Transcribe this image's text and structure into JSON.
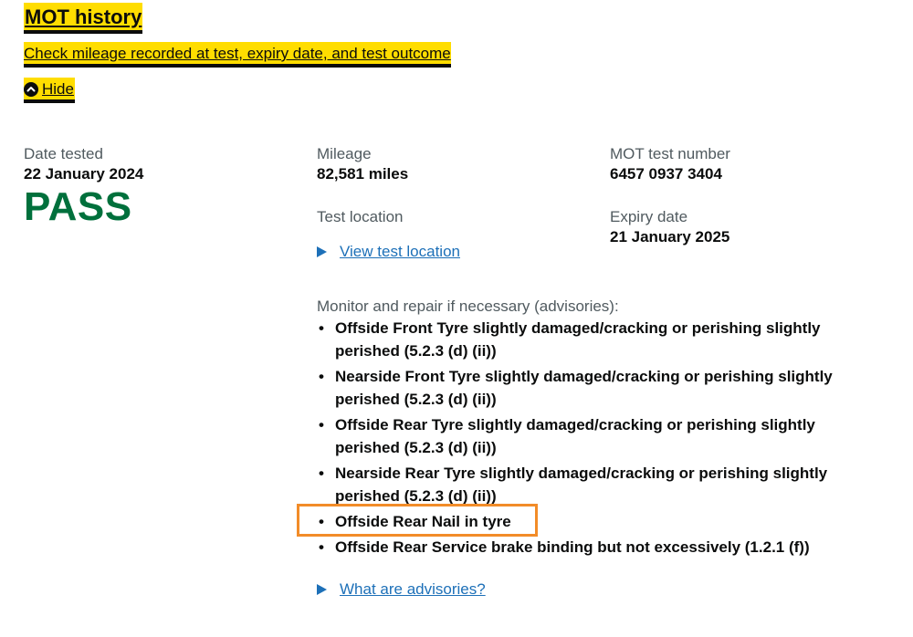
{
  "section": {
    "title": "MOT history",
    "summary": "Check mileage recorded at test, expiry date, and test outcome",
    "hide_label": "Hide"
  },
  "test": {
    "date_label": "Date tested",
    "date_value": "22 January 2024",
    "result": "PASS",
    "mileage_label": "Mileage",
    "mileage_value": "82,581 miles",
    "location_label": "Test location",
    "view_location_link": "View test location",
    "test_number_label": "MOT test number",
    "test_number_value": "6457 0937 3404",
    "expiry_label": "Expiry date",
    "expiry_value": "21 January 2025"
  },
  "advisories": {
    "heading": "Monitor and repair if necessary (advisories):",
    "items": [
      "Offside Front Tyre slightly damaged/cracking or perishing slightly perished (5.2.3 (d) (ii))",
      "Nearside Front Tyre slightly damaged/cracking or perishing slightly perished (5.2.3 (d) (ii))",
      "Offside Rear Tyre slightly damaged/cracking or perishing slightly perished (5.2.3 (d) (ii))",
      "Nearside Rear Tyre slightly damaged/cracking or perishing slightly perished (5.2.3 (d) (ii))",
      "Offside Rear Nail in tyre",
      "Offside Rear Service brake binding but not excessively (1.2.1 (f))"
    ],
    "what_are_link": "What are advisories?"
  },
  "colors": {
    "focus": "#ffdd00",
    "pass_green": "#00703c",
    "link_blue": "#1d70b8",
    "highlight_orange": "#f28c28"
  }
}
